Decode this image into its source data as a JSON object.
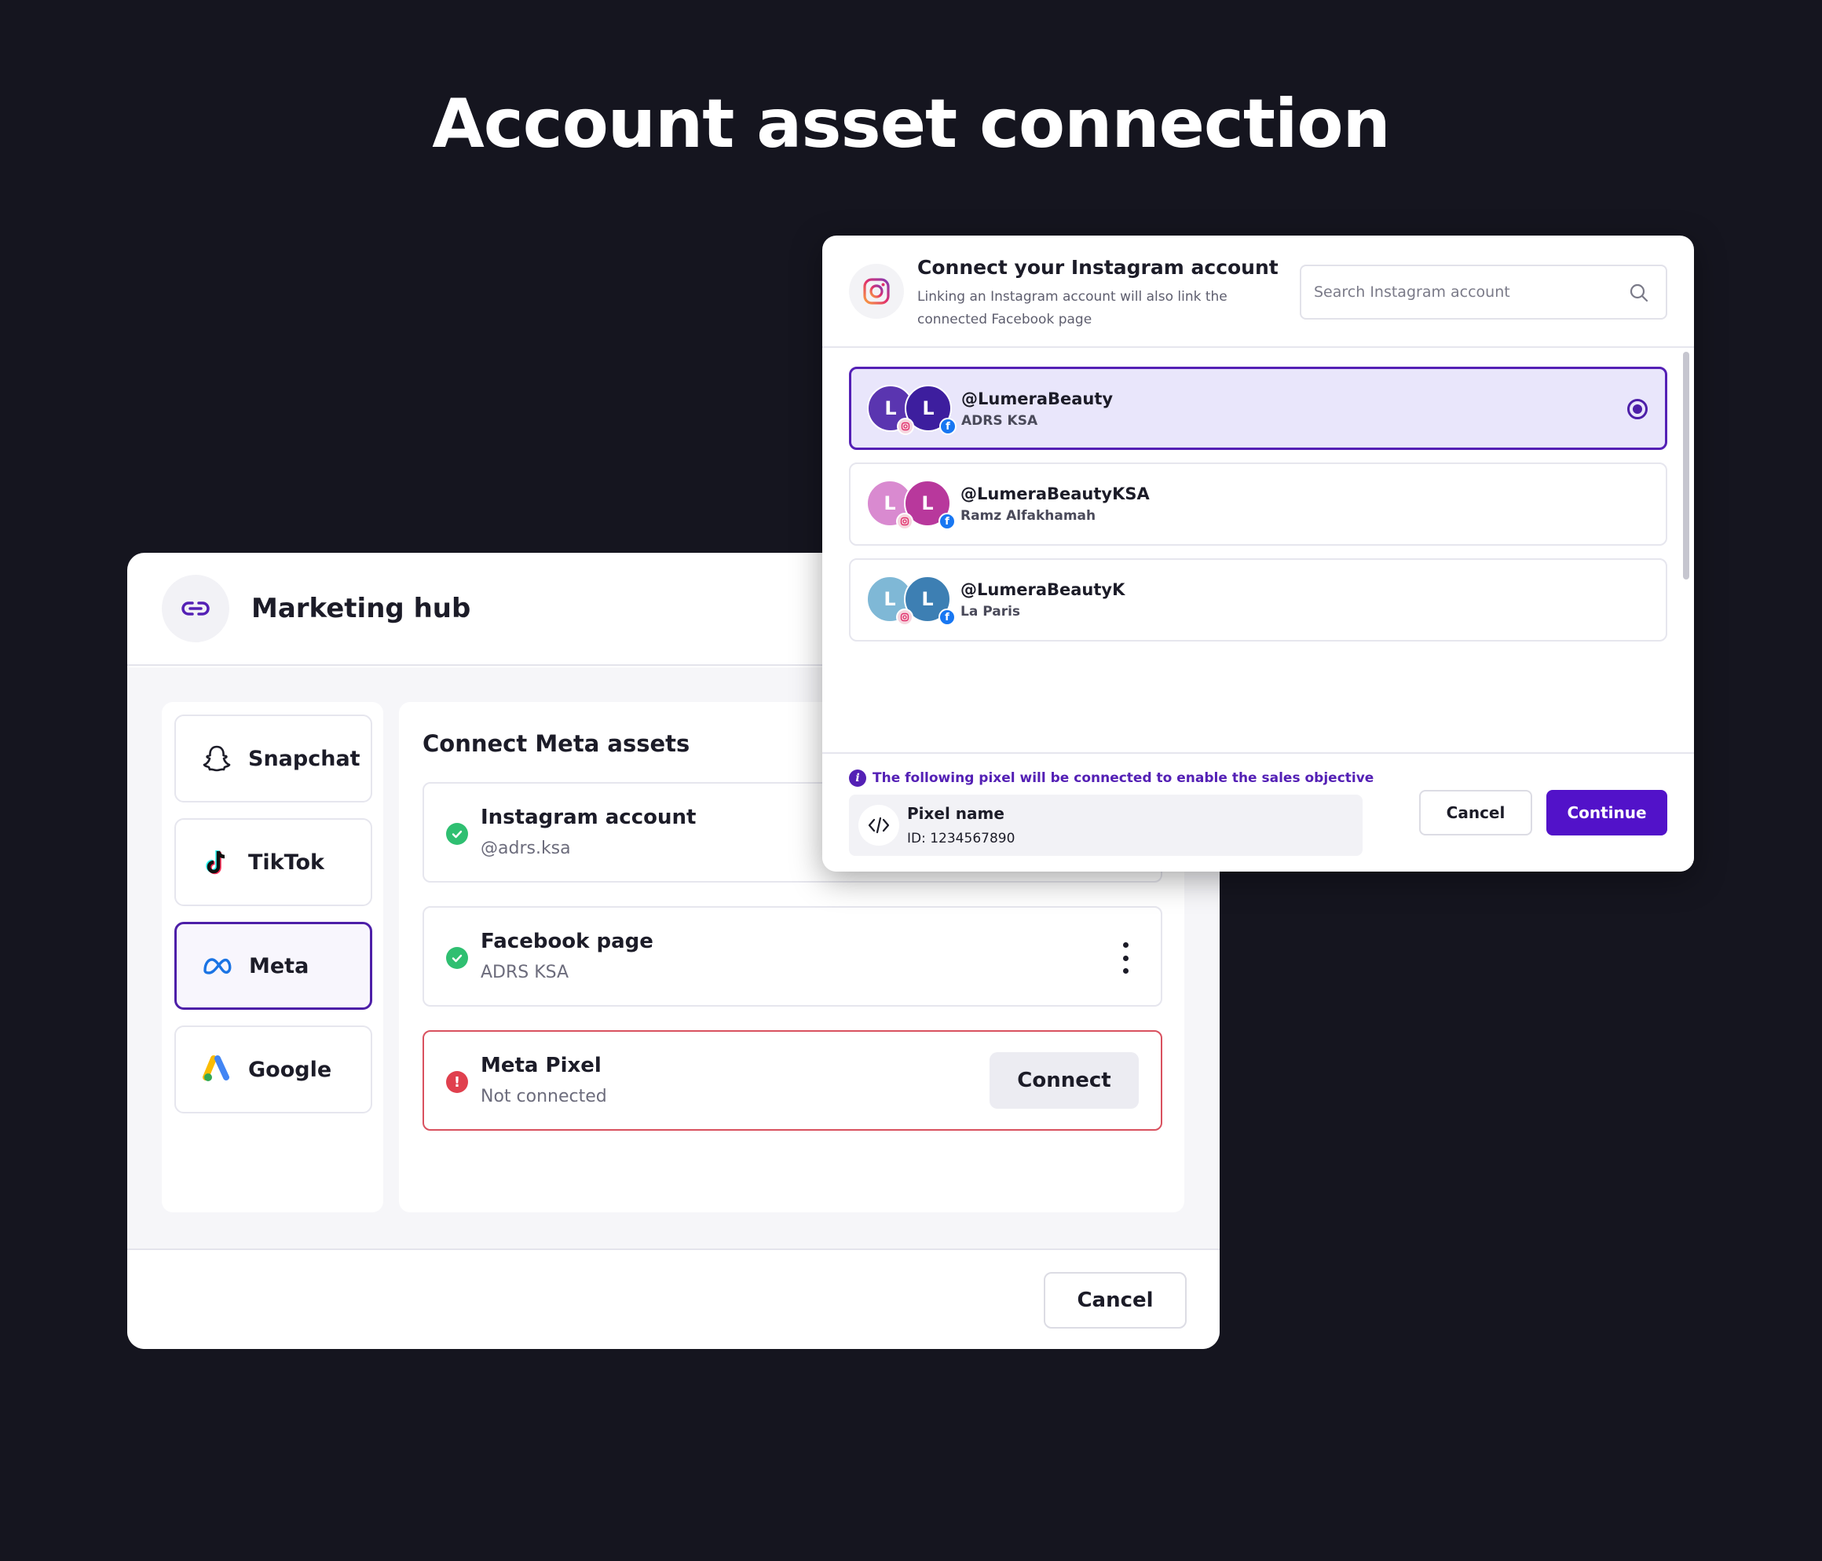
{
  "headline": "Account asset connection",
  "hub": {
    "title": "Marketing hub",
    "sidebar": {
      "items": [
        {
          "label": "Snapchat",
          "icon": "snapchat-icon",
          "active": false
        },
        {
          "label": "TikTok",
          "icon": "tiktok-icon",
          "active": false
        },
        {
          "label": "Meta",
          "icon": "meta-icon",
          "active": true
        },
        {
          "label": "Google",
          "icon": "google-ads-icon",
          "active": false
        }
      ]
    },
    "content": {
      "title": "Connect Meta assets",
      "assets": [
        {
          "title": "Instagram account",
          "subtitle": "@adrs.ksa",
          "status": "connected"
        },
        {
          "title": "Facebook page",
          "subtitle": "ADRS KSA",
          "status": "connected"
        },
        {
          "title": "Meta Pixel",
          "subtitle": "Not connected",
          "status": "error",
          "action": "Connect"
        }
      ]
    },
    "footer": {
      "cancel_label": "Cancel"
    }
  },
  "modal": {
    "title": "Connect your Instagram account",
    "subtitle": "Linking an Instagram account will also link the connected Facebook page",
    "search": {
      "placeholder": "Search Instagram account",
      "value": ""
    },
    "accounts": [
      {
        "initial": "L",
        "handle": "@LumeraBeauty",
        "page": "ADRS KSA",
        "selected": true
      },
      {
        "initial": "L",
        "handle": "@LumeraBeautyKSA",
        "page": "Ramz Alfakhamah",
        "selected": false
      },
      {
        "initial": "L",
        "handle": "@LumeraBeautyK",
        "page": "La Paris",
        "selected": false
      }
    ],
    "footer": {
      "info_text": "The following pixel will be connected to enable the sales objective",
      "pixel_name": "Pixel name",
      "pixel_id": "ID: 1234567890",
      "cancel_label": "Cancel",
      "continue_label": "Continue"
    }
  },
  "colors": {
    "background": "#15151f",
    "accent": "#5212c9",
    "selected_bg": "#e9e6fb",
    "success": "#2fbf71",
    "error": "#e0404e",
    "facebook_blue": "#1877f2"
  }
}
